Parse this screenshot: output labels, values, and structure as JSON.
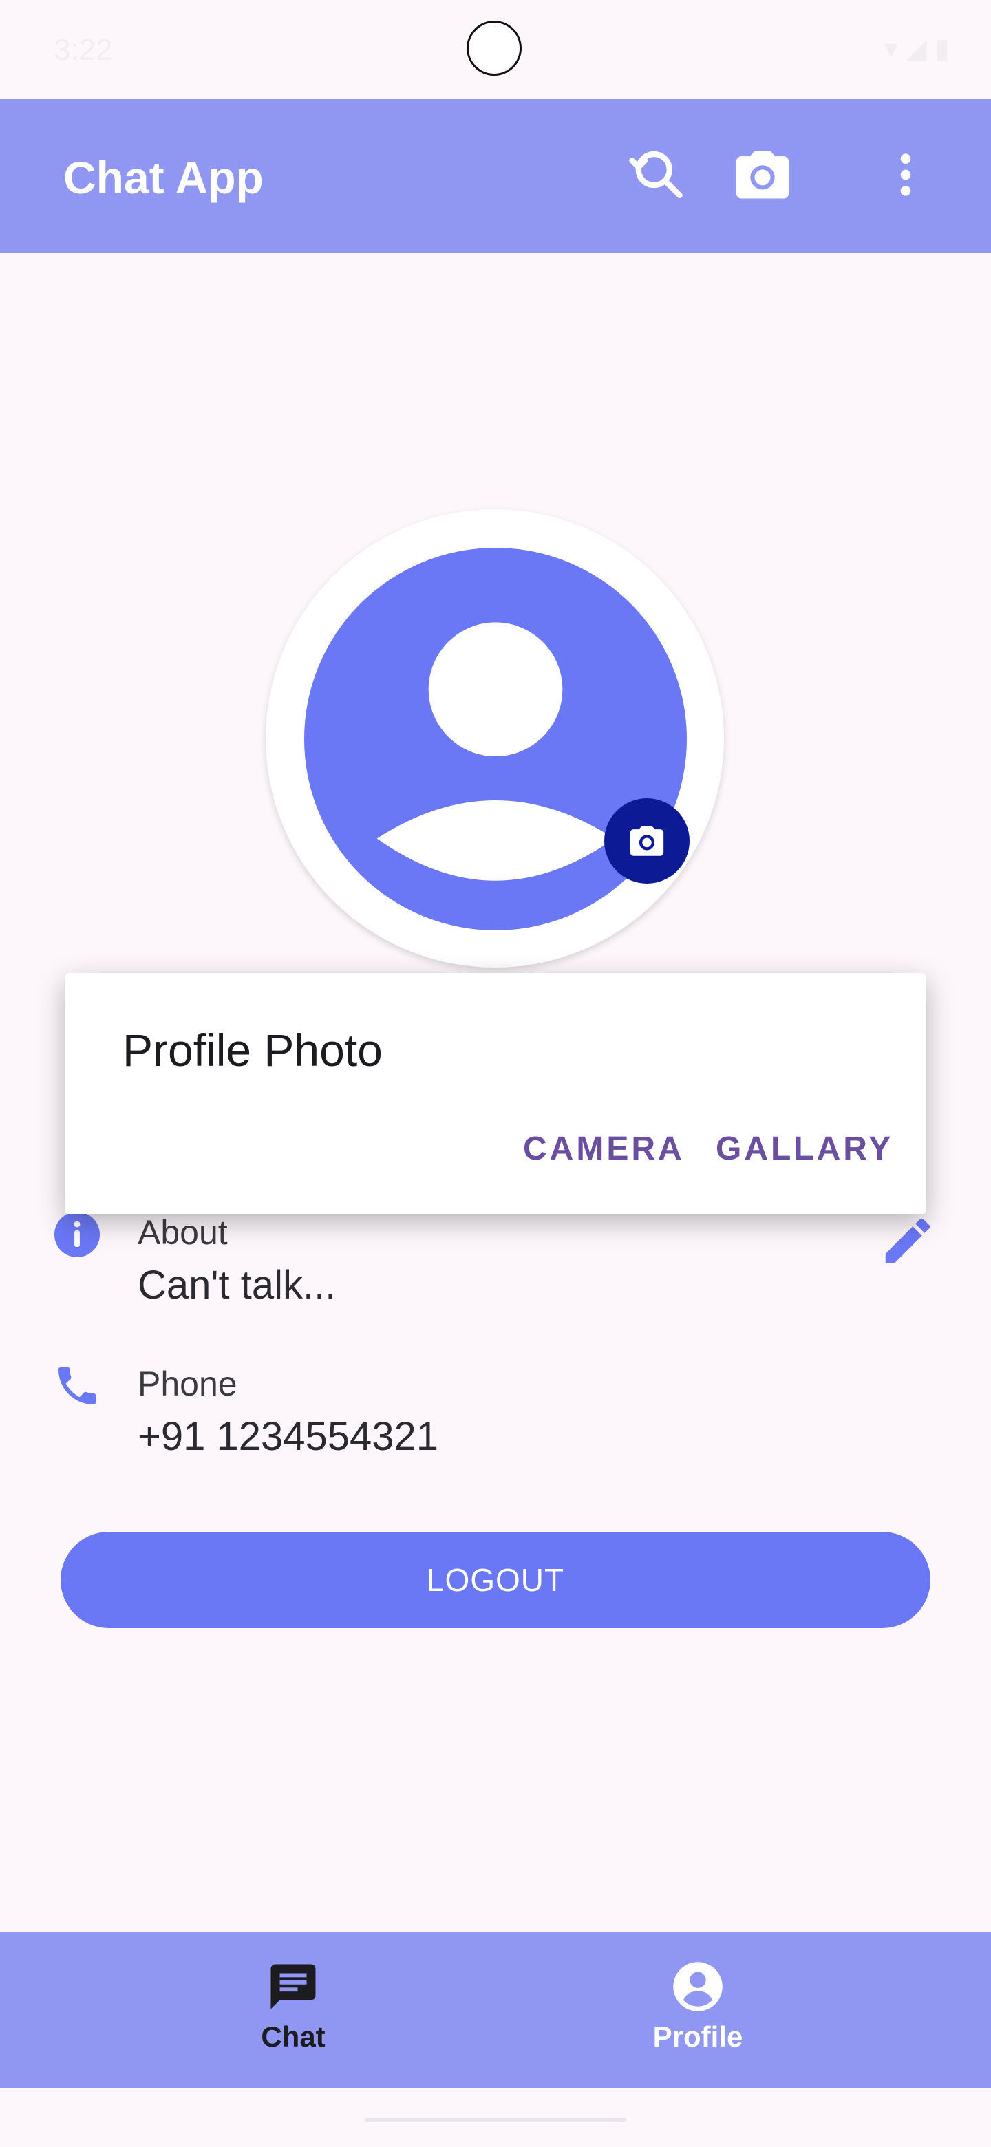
{
  "status_bar": {
    "time": "3:22"
  },
  "app_bar": {
    "title": "Chat App",
    "icons": [
      "search-refresh-icon",
      "camera-icon",
      "more-vert-icon"
    ]
  },
  "profile": {
    "fab_icon": "camera-icon"
  },
  "about": {
    "label": "About",
    "value": "Can't talk...",
    "icon": "info-icon"
  },
  "phone": {
    "label": "Phone",
    "value": "+91 1234554321",
    "icon": "phone-icon"
  },
  "logout": {
    "label": "LOGOUT"
  },
  "dialog": {
    "title": "Profile Photo",
    "camera_label": "CAMERA",
    "gallery_label": "GALLARY"
  },
  "bottom_nav": {
    "chat_label": "Chat",
    "profile_label": "Profile"
  },
  "colors": {
    "app_bar": "#8f97f2",
    "accent": "#6b78f6",
    "fab": "#0d1a96",
    "dialog_button": "#6a4fa0"
  }
}
